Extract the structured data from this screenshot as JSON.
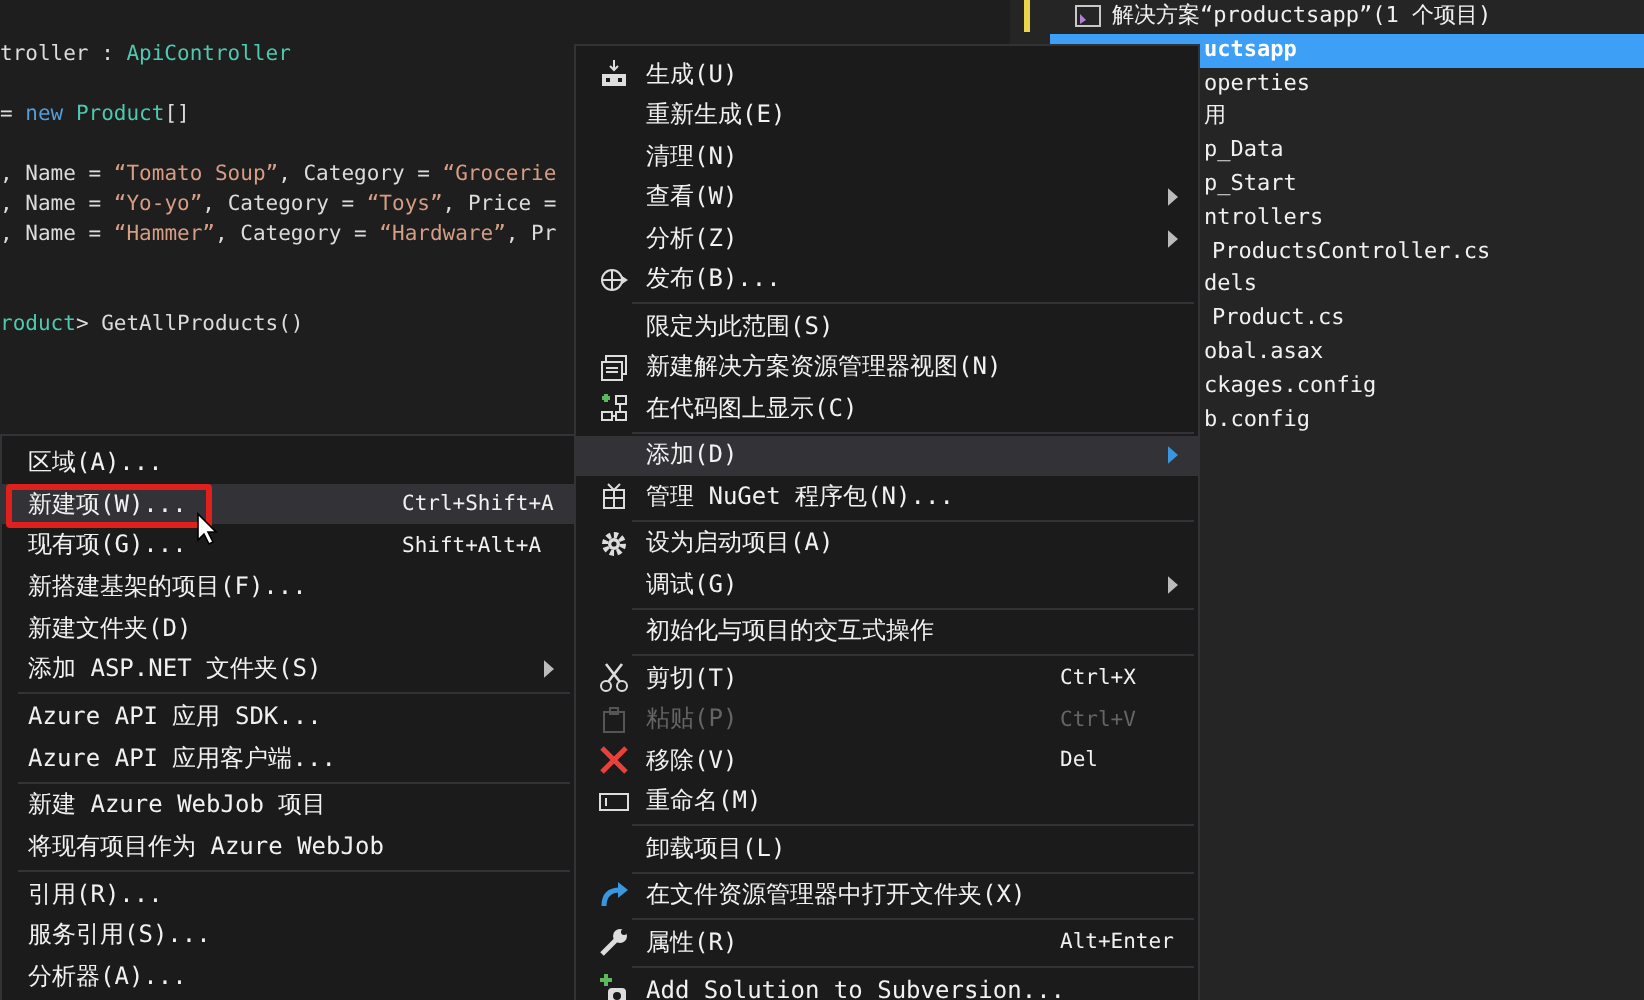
{
  "editor": {
    "lines": [
      {
        "segments": [
          {
            "text": "troller : ",
            "kind": "plain"
          },
          {
            "text": "ApiController",
            "kind": "type"
          }
        ]
      },
      {
        "segments": [
          {
            "text": "= ",
            "kind": "plain"
          },
          {
            "text": "new ",
            "kind": "keyword"
          },
          {
            "text": "Product",
            "kind": "type"
          },
          {
            "text": "[]",
            "kind": "plain"
          }
        ]
      },
      {
        "segments": [
          {
            "text": ", Name = ",
            "kind": "plain"
          },
          {
            "text": "“Tomato Soup”",
            "kind": "string"
          },
          {
            "text": ", Category = ",
            "kind": "plain"
          },
          {
            "text": "“Grocerie",
            "kind": "string"
          }
        ]
      },
      {
        "segments": [
          {
            "text": ", Name = ",
            "kind": "plain"
          },
          {
            "text": "“Yo-yo”",
            "kind": "string"
          },
          {
            "text": ", Category = ",
            "kind": "plain"
          },
          {
            "text": "“Toys”",
            "kind": "string"
          },
          {
            "text": ", Price =",
            "kind": "plain"
          }
        ]
      },
      {
        "segments": [
          {
            "text": ", Name = ",
            "kind": "plain"
          },
          {
            "text": "“Hammer”",
            "kind": "string"
          },
          {
            "text": ", Category = ",
            "kind": "plain"
          },
          {
            "text": "“Hardware”",
            "kind": "string"
          },
          {
            "text": ", Pr",
            "kind": "plain"
          }
        ]
      },
      {
        "segments": [
          {
            "text": "roduct",
            "kind": "type"
          },
          {
            "text": "> GetAllProducts()",
            "kind": "plain"
          }
        ]
      }
    ]
  },
  "solution_explorer": {
    "tree": [
      {
        "label": "解决方案“productsapp”(1 个项目)",
        "selected": false,
        "children": [
          {
            "label": "uctsapp",
            "selected": true,
            "children": [
              {
                "label": "operties",
                "selected": false
              },
              {
                "label": "用",
                "selected": false
              },
              {
                "label": "p_Data",
                "selected": false
              },
              {
                "label": "p_Start",
                "selected": false
              },
              {
                "label": "ntrollers",
                "selected": false,
                "children": [
                  {
                    "label": "ProductsController.cs",
                    "selected": false
                  }
                ]
              },
              {
                "label": "dels",
                "selected": false,
                "children": [
                  {
                    "label": "Product.cs",
                    "selected": false
                  }
                ]
              },
              {
                "label": "obal.asax",
                "selected": false
              },
              {
                "label": "ckages.config",
                "selected": false
              },
              {
                "label": "b.config",
                "selected": false
              }
            ]
          }
        ]
      }
    ]
  },
  "context_menu": {
    "groups": [
      [
        {
          "label": "生成(U)",
          "submenu": false,
          "disabled": false,
          "highlighted": false
        },
        {
          "label": "重新生成(E)",
          "submenu": false,
          "disabled": false,
          "highlighted": false
        },
        {
          "label": "清理(N)",
          "submenu": false,
          "disabled": false,
          "highlighted": false
        },
        {
          "label": "查看(W)",
          "submenu": true,
          "disabled": false,
          "highlighted": false
        },
        {
          "label": "分析(Z)",
          "submenu": true,
          "disabled": false,
          "highlighted": false
        },
        {
          "label": "发布(B)...",
          "submenu": false,
          "disabled": false,
          "highlighted": false
        }
      ],
      [
        {
          "label": "限定为此范围(S)",
          "submenu": false,
          "disabled": false,
          "highlighted": false
        },
        {
          "label": "新建解决方案资源管理器视图(N)",
          "submenu": false,
          "disabled": false,
          "highlighted": false
        },
        {
          "label": "在代码图上显示(C)",
          "submenu": false,
          "disabled": false,
          "highlighted": false
        }
      ],
      [
        {
          "label": "添加(D)",
          "submenu": true,
          "disabled": false,
          "highlighted": true
        },
        {
          "label": "管理 NuGet 程序包(N)...",
          "submenu": false,
          "disabled": false,
          "highlighted": false
        }
      ],
      [
        {
          "label": "设为启动项目(A)",
          "submenu": false,
          "disabled": false,
          "highlighted": false
        },
        {
          "label": "调试(G)",
          "submenu": true,
          "disabled": false,
          "highlighted": false
        }
      ],
      [
        {
          "label": "初始化与项目的交互式操作",
          "submenu": false,
          "disabled": false,
          "highlighted": false
        }
      ],
      [
        {
          "label": "剪切(T)",
          "shortcut": "Ctrl+X",
          "submenu": false,
          "disabled": false,
          "highlighted": false
        },
        {
          "label": "粘贴(P)",
          "shortcut": "Ctrl+V",
          "submenu": false,
          "disabled": true,
          "highlighted": false
        },
        {
          "label": "移除(V)",
          "shortcut": "Del",
          "submenu": false,
          "disabled": false,
          "highlighted": false
        },
        {
          "label": "重命名(M)",
          "submenu": false,
          "disabled": false,
          "highlighted": false
        }
      ],
      [
        {
          "label": "卸载项目(L)",
          "submenu": false,
          "disabled": false,
          "highlighted": false
        }
      ],
      [
        {
          "label": "在文件资源管理器中打开文件夹(X)",
          "submenu": false,
          "disabled": false,
          "highlighted": false
        }
      ],
      [
        {
          "label": "属性(R)",
          "shortcut": "Alt+Enter",
          "submenu": false,
          "disabled": false,
          "highlighted": false
        }
      ],
      [
        {
          "label": "Add Solution to Subversion...",
          "submenu": false,
          "disabled": false,
          "highlighted": false
        }
      ]
    ]
  },
  "add_submenu": {
    "groups": [
      [
        {
          "label": "区域(A)...",
          "submenu": false,
          "disabled": false,
          "highlighted": false
        },
        {
          "label": "新建项(W)...",
          "shortcut": "Ctrl+Shift+A",
          "submenu": false,
          "disabled": false,
          "highlighted": true
        },
        {
          "label": "现有项(G)...",
          "shortcut": "Shift+Alt+A",
          "submenu": false,
          "disabled": false,
          "highlighted": false
        },
        {
          "label": "新搭建基架的项目(F)...",
          "submenu": false,
          "disabled": false,
          "highlighted": false
        },
        {
          "label": "新建文件夹(D)",
          "submenu": false,
          "disabled": false,
          "highlighted": false
        },
        {
          "label": "添加 ASP.NET 文件夹(S)",
          "submenu": true,
          "disabled": false,
          "highlighted": false
        }
      ],
      [
        {
          "label": "Azure API 应用 SDK...",
          "submenu": false,
          "disabled": false,
          "highlighted": false
        },
        {
          "label": "Azure API 应用客户端...",
          "submenu": false,
          "disabled": false,
          "highlighted": false
        }
      ],
      [
        {
          "label": "新建 Azure WebJob 项目",
          "submenu": false,
          "disabled": false,
          "highlighted": false
        },
        {
          "label": "将现有项目作为 Azure WebJob",
          "submenu": false,
          "disabled": false,
          "highlighted": false
        }
      ],
      [
        {
          "label": "引用(R)...",
          "submenu": false,
          "disabled": false,
          "highlighted": false
        },
        {
          "label": "服务引用(S)...",
          "submenu": false,
          "disabled": false,
          "highlighted": false
        },
        {
          "label": "分析器(A)...",
          "submenu": false,
          "disabled": false,
          "highlighted": false
        }
      ]
    ]
  }
}
